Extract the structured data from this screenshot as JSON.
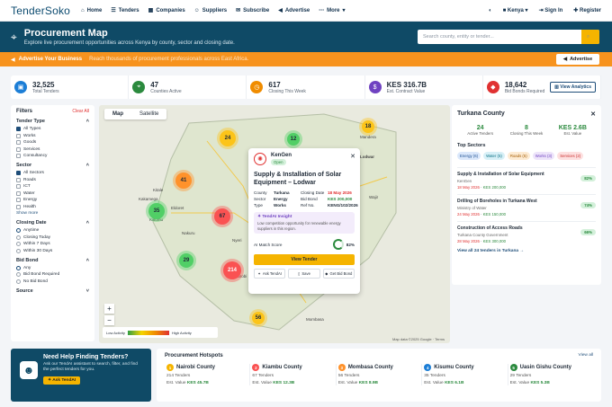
{
  "nav": {
    "logo": "TenderSoko",
    "links": [
      "Home",
      "Tenders",
      "Companies",
      "Suppliers",
      "Subscribe",
      "Advertise",
      "More"
    ],
    "country": "Kenya",
    "signin": "Sign In",
    "register": "Register"
  },
  "hero": {
    "title": "Procurement Map",
    "subtitle": "Explore live procurement opportunities across Kenya by county, sector and closing date.",
    "search_placeholder": "Search county, entity or tender..."
  },
  "promo": {
    "label": "Advertise Your Business",
    "text": "Reach thousands of procurement professionals across East Africa.",
    "button": "Advertise"
  },
  "stats": [
    {
      "value": "32,525",
      "label": "Total Tenders",
      "color": "#1c7ed6"
    },
    {
      "value": "47",
      "label": "Counties Active",
      "color": "#2b8a3e"
    },
    {
      "value": "617",
      "label": "Closing This Week",
      "color": "#f08c00"
    },
    {
      "value": "KES 316.7B",
      "label": "Est. Contract Value",
      "color": "#6f42c1"
    },
    {
      "value": "18,642",
      "label": "Bid Bonds Required",
      "color": "#e03131"
    }
  ],
  "view_analytics": "View Analytics",
  "filters": {
    "title": "Filters",
    "clear": "Clear All",
    "tender_type": {
      "title": "Tender Type",
      "options": [
        "All Types",
        "Works",
        "Goods",
        "Services",
        "Consultancy"
      ]
    },
    "sector": {
      "title": "Sector",
      "options": [
        "All Sectors",
        "Roads",
        "ICT",
        "Water",
        "Energy",
        "Health"
      ],
      "more": "Show more"
    },
    "closing": {
      "title": "Closing Date",
      "options": [
        "Anytime",
        "Closing Today",
        "Within 7 Days",
        "Within 30 Days"
      ]
    },
    "bidbond": {
      "title": "Bid Bond",
      "options": [
        "Any",
        "Bid Bond Required",
        "No Bid Bond"
      ]
    },
    "source": {
      "title": "Source"
    }
  },
  "map": {
    "tabs": [
      "Map",
      "Satellite"
    ],
    "clusters": [
      "24",
      "18",
      "12",
      "41",
      "35",
      "67",
      "29",
      "214",
      "56"
    ],
    "places": [
      "Lodwar",
      "Marsabit",
      "Mandera",
      "Wajir",
      "Kitale",
      "Eldoret",
      "Kisumu",
      "Nakuru",
      "Nyeri",
      "Garissa",
      "Nairobi",
      "Mombasa",
      "Kakamega"
    ],
    "legend_low": "Low Activity",
    "legend_high": "High Activity",
    "attribution": "Map data ©2025 Google · Terms"
  },
  "popup": {
    "entity": "KenGen",
    "status": "Open",
    "title": "Supply & Installation of Solar Equipment – Lodwar",
    "rows": [
      [
        "County",
        "Turkana",
        "Closing Date",
        "18 May 2026"
      ],
      [
        "Sector",
        "Energy",
        "Bid Bond",
        "KES 200,000"
      ],
      [
        "Type",
        "Works",
        "Ref No.",
        "KENG/102/2026"
      ]
    ],
    "insight_title": "TendAI Insight",
    "insight_text": "Low competition opportunity for renewable energy suppliers in this region.",
    "match_label": "AI Match Score",
    "match_value": "82%",
    "view": "View Tender",
    "actions": [
      "Ask TendAI",
      "Save",
      "Get Bid Bond"
    ]
  },
  "county": {
    "title": "Turkana County",
    "stats": [
      {
        "v": "24",
        "l": "Active Tenders"
      },
      {
        "v": "8",
        "l": "Closing This Week"
      },
      {
        "v": "KES 2.6B",
        "l": "Est. Value"
      }
    ],
    "top_sectors_title": "Top Sectors",
    "sectors": [
      "Energy (6)",
      "Water (5)",
      "Roads (5)",
      "Works (3)",
      "Services (2)"
    ],
    "tenders": [
      {
        "title": "Supply & Installation of Solar Equipment",
        "org": "KenGen",
        "date": "18 May 2026",
        "value": "KES 200,000",
        "pct": "82%"
      },
      {
        "title": "Drilling of Boreholes in Turkana West",
        "org": "Ministry of Water",
        "date": "24 May 2026",
        "value": "KES 150,000",
        "pct": "74%"
      },
      {
        "title": "Construction of Access Roads",
        "org": "Turkana County Government",
        "date": "28 May 2026",
        "value": "KES 300,000",
        "pct": "66%"
      }
    ],
    "view_all": "View all 24 tenders in Turkana →"
  },
  "help": {
    "title": "Need Help Finding Tenders?",
    "text": "Ask our TendAI assistant to search, filter, and find the perfect tenders for you.",
    "button": "Ask TendAI"
  },
  "hotspots": {
    "title": "Procurement Hotspots",
    "view_all": "View all",
    "items": [
      {
        "rank": "1",
        "name": "Nairobi County",
        "tenders": "214 Tenders",
        "value": "KES 45.7B"
      },
      {
        "rank": "2",
        "name": "Kiambu County",
        "tenders": "67 Tenders",
        "value": "KES 12.3B"
      },
      {
        "rank": "3",
        "name": "Mombasa County",
        "tenders": "56 Tenders",
        "value": "KES 8.9B"
      },
      {
        "rank": "4",
        "name": "Kisumu County",
        "tenders": "35 Tenders",
        "value": "KES 6.1B"
      },
      {
        "rank": "5",
        "name": "Uasin Gishu County",
        "tenders": "29 Tenders",
        "value": "KES 5.3B"
      }
    ],
    "value_label": "Est. Value"
  }
}
